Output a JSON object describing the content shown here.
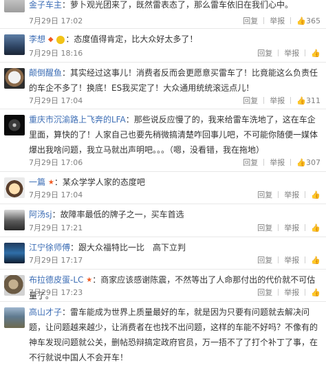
{
  "action_labels": {
    "reply": "回复",
    "report": "举报"
  },
  "comments": [
    {
      "user": "金子车主",
      "text": "：萝卜观光团来了，既然雷表态了，那么雷车依旧在我们心中。",
      "time": "7月29日 17:02",
      "likes": "365"
    },
    {
      "user": "李想",
      "text": "：态度值得肯定，比大众好太多了！",
      "time": "7月29日 18:16",
      "likes": ""
    },
    {
      "user": "颠倒醒鱼",
      "text": "：其实经过这事儿！消费者反而会更愿意买雷车了！比竟能这么负责任的车企不多了！换底！ES我买定了！大众通用统统滚远点儿！",
      "time": "7月29日 17:04",
      "likes": "311"
    },
    {
      "user": "重庆市沉渝路上飞奔的LFA",
      "text": "：那些说反应慢了的，我来给雷车洗地了，这在车企里面，算快的了！人家自己也要先稍微搞清楚咋回事儿吧，不可能你随便一媒体爆出我啥问题，我立马就出声明吧。。。（嗯，没看错，我在拖地）",
      "time": "7月29日 17:06",
      "likes": "307"
    },
    {
      "user": "一篇",
      "text": "：某众学学人家的态度吧",
      "time": "7月29日 17:04",
      "likes": ""
    },
    {
      "user": "阿汤sj",
      "text": "：故障率最低的牌子之一，买车首选",
      "time": "7月29日 17:21",
      "likes": ""
    },
    {
      "user": "江宁徐师傅",
      "text": "：跟大众福特比一比　高下立判",
      "time": "7月29日 17:17",
      "likes": ""
    },
    {
      "user": "布拉德皮蛋-LC",
      "text": "：商家应该感谢陈震，不然等出了人命那付出的代价就不可估量了。",
      "time": "7月29日 17:23",
      "likes": ""
    },
    {
      "user": "高山才子",
      "text": "：雷车能成为世界上质量最好的车，就是因为只要有问题就去解决问题，让问题越来越少，让消费者在也找不出问题，这样的车能不好吗？不像有的神车发现问题就公关，删帖恐辩搞定政府官员，万一捂不了了打个补丁了事，在不行就说中国人不会开车！",
      "time": "",
      "likes": ""
    }
  ],
  "colors": {
    "username": "#3d6eb5",
    "text": "#333333",
    "meta": "#808080",
    "divider": "#e8e8e8"
  }
}
